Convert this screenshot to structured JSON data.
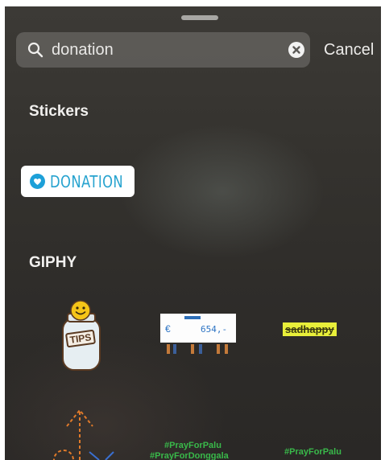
{
  "search": {
    "value": "donation",
    "cancel_label": "Cancel"
  },
  "sections": {
    "stickers_title": "Stickers",
    "giphy_title": "GIPHY"
  },
  "stickers": {
    "donation_label": "DONATION"
  },
  "giphy": {
    "tips_label": "TIPS",
    "sign_currency": "€",
    "sign_amount": "654,-",
    "sadhappy_label": "sadhappy",
    "pray_palu_1": "#PrayForPalu",
    "pray_donggala": "#PrayForDonggala",
    "pray_palu_2": "#PrayForPalu"
  },
  "colors": {
    "donation_accent": "#1da0d8",
    "sadhappy_bg": "#e8ef3a",
    "pray_green": "#39b94a"
  },
  "icons": [
    "search-icon",
    "clear-icon",
    "heart-icon",
    "smiley-icon"
  ]
}
